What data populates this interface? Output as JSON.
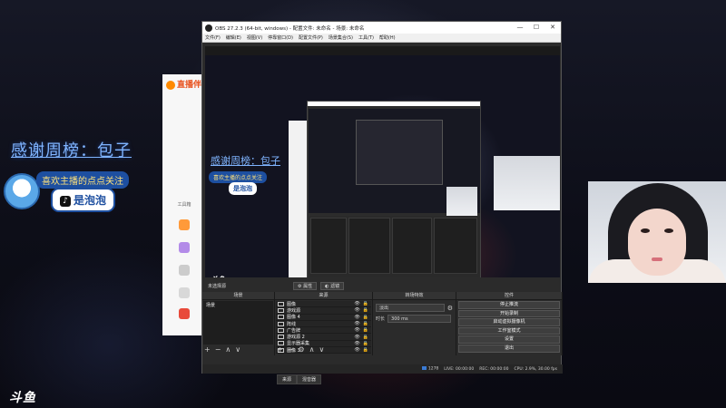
{
  "stream": {
    "thanks_text": "感谢周榜：包子",
    "follow_line1": "喜欢主播的点点关注",
    "follow_line2": "是泡泡",
    "tiktok_glyph": "♪",
    "douyu_logo": "斗鱼"
  },
  "app_panel": {
    "brand": "直播伴",
    "items": [
      "工具箱",
      "",
      "",
      ""
    ]
  },
  "obs": {
    "title": "OBS 27.2.3 (64-bit, windows) - 配置文件: 未命名 - 场景: 未命名",
    "window_controls": {
      "minimize": "—",
      "maximize": "☐",
      "close": "✕"
    },
    "menu": [
      "文件(F)",
      "编辑(E)",
      "视图(V)",
      "停靠窗口(D)",
      "配置文件(P)",
      "场景集合(S)",
      "工具(T)",
      "帮助(H)"
    ],
    "no_source_label": "未选择源",
    "props_button": "属性",
    "filters_button": "滤镜",
    "docks": {
      "scenes_header": "场景",
      "sources_header": "来源",
      "transitions_header": "转场特效",
      "controls_header": "控件"
    },
    "scenes": [
      "场景"
    ],
    "sources": [
      {
        "label": "图像"
      },
      {
        "label": "游戏源"
      },
      {
        "label": "图像 4"
      },
      {
        "label": "阵线"
      },
      {
        "label": "广告牌"
      },
      {
        "label": "游戏源 2"
      },
      {
        "label": "显示器采集"
      },
      {
        "label": "图像 3"
      }
    ],
    "source_icons": {
      "eye": "👁",
      "lock": "🔒"
    },
    "toolbar_glyphs": [
      "+",
      "−",
      "⚙",
      "∧",
      "∨"
    ],
    "transition_select": "淡出",
    "duration_label": "时长",
    "duration_value": "300 ms",
    "controls": [
      "停止推流",
      "开始录制",
      "启动虚拟摄像机",
      "工作室模式",
      "设置",
      "退出"
    ],
    "tabs": [
      "来源",
      "混音器"
    ],
    "status": {
      "live": "LIVE: 00:00:00",
      "rec": "REC: 00:00:00",
      "cpu": "CPU: 2.9%, 30.00 fps",
      "kbps": "1278"
    }
  },
  "colors": {
    "accent": "#3a7bd5",
    "thanks": "#7fb4ff",
    "follow_bg": "#1d4fa0"
  }
}
